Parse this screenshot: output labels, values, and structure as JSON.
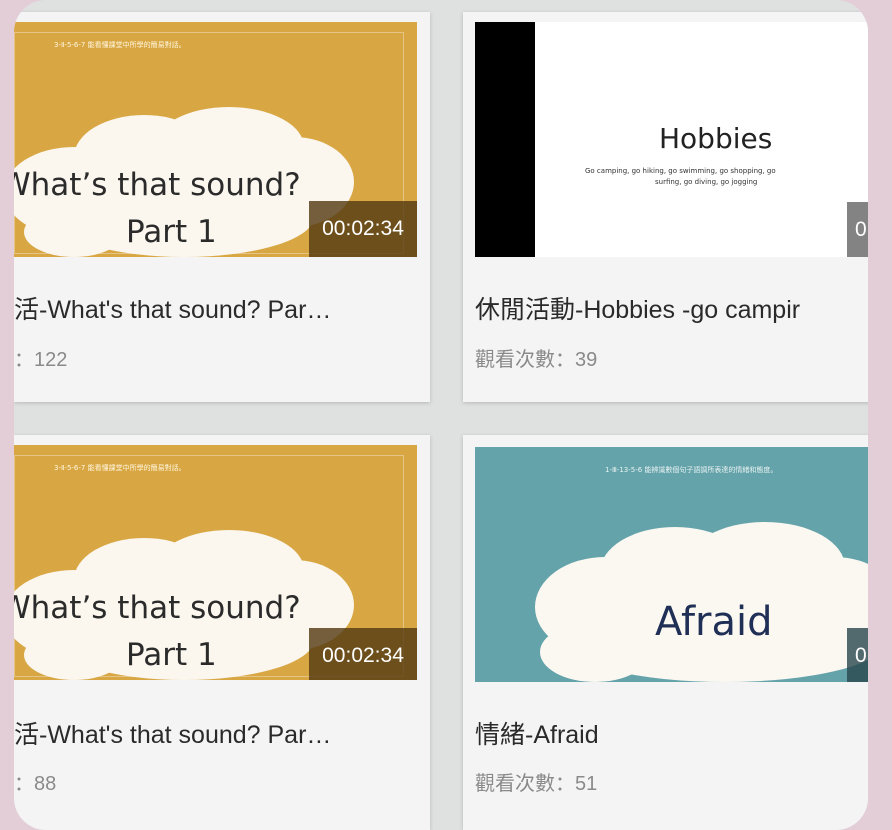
{
  "videos": [
    {
      "title": "活-What's that sound? Par…",
      "views": "：122",
      "duration": "00:02:34",
      "slide_line1": "What’s that sound?",
      "slide_line2": "Part 1",
      "slide_caption": "3-Ⅱ-5-6-7  能看懂課堂中所學的簡易對話。"
    },
    {
      "title": "休閒活動-Hobbies -go campir",
      "views": "觀看次數：39",
      "duration": "0",
      "slide_heading": "Hobbies",
      "slide_subtext_1": "Go camping, go hiking, go swimming, go shopping, go",
      "slide_subtext_2": "surfing, go diving, go jogging"
    },
    {
      "title": "活-What's that sound? Par…",
      "views": "：88",
      "duration": "00:02:34",
      "slide_line1": "What’s that sound?",
      "slide_line2": "Part 1",
      "slide_caption": "3-Ⅱ-5-6-7  能看懂課堂中所學的簡易對話。"
    },
    {
      "title": "情緒-Afraid",
      "views": "觀看次數：51",
      "duration": "0",
      "slide_heading": "Afraid",
      "slide_caption": "1-Ⅲ-13-5-6  能辨識數個句子語調所表達的情緒和態度。"
    }
  ],
  "colors": {
    "page_bg": "#e3ced8",
    "thumb_gold": "#d8a744",
    "thumb_teal": "#65a3aa",
    "duration_bg": "#553c14"
  }
}
